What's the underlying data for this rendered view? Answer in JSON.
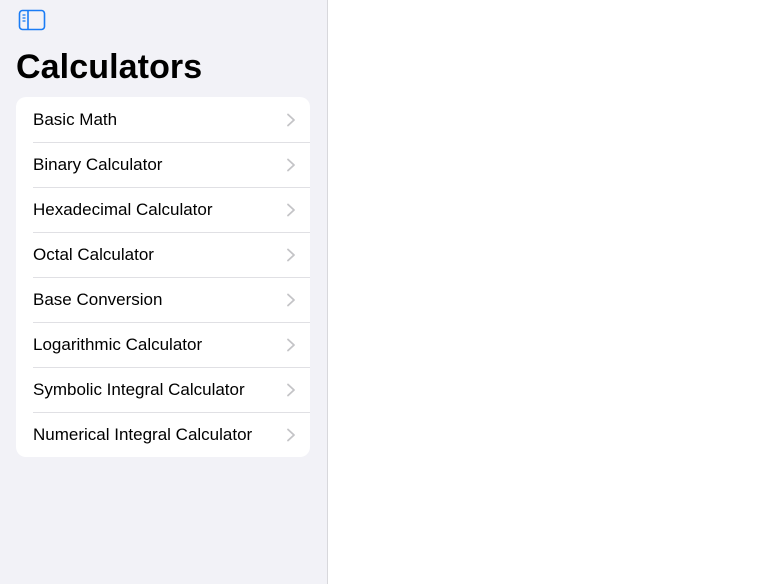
{
  "sidebar": {
    "toggle_icon": "sidebar-left-icon",
    "title": "Calculators",
    "items": [
      {
        "label": "Basic Math"
      },
      {
        "label": "Binary Calculator"
      },
      {
        "label": "Hexadecimal Calculator"
      },
      {
        "label": "Octal Calculator"
      },
      {
        "label": "Base Conversion"
      },
      {
        "label": "Logarithmic Calculator"
      },
      {
        "label": "Symbolic Integral Calculator"
      },
      {
        "label": "Numerical Integral Calculator"
      }
    ],
    "chevron_icon": "chevron-right-icon"
  },
  "colors": {
    "accent": "#1a7cf5",
    "sidebar_background": "#f2f2f7",
    "list_background": "#ffffff",
    "chevron": "#c4c4c7"
  }
}
